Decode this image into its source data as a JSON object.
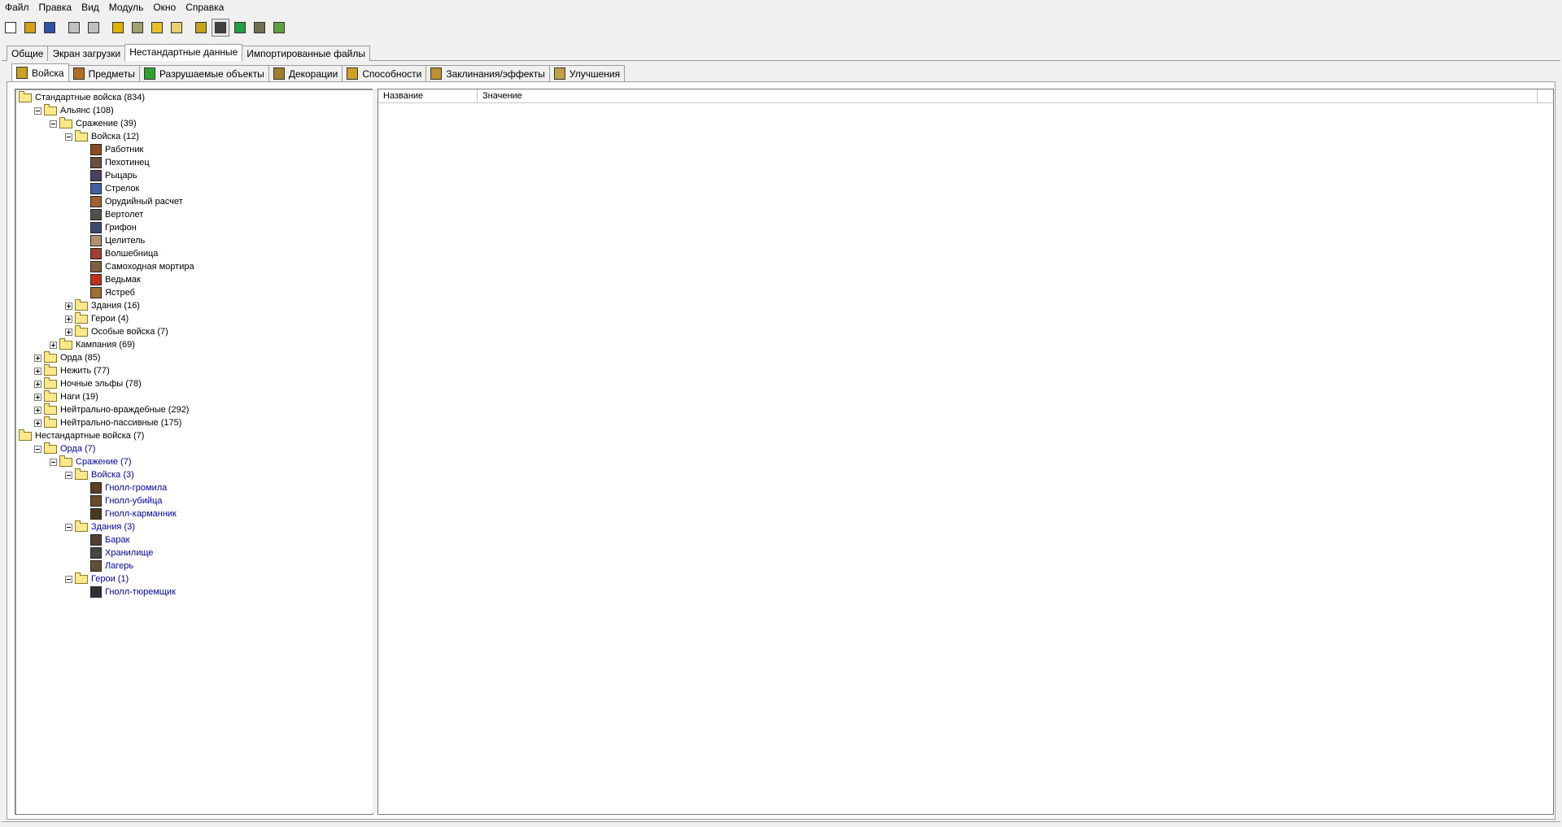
{
  "menu": [
    "Файл",
    "Правка",
    "Вид",
    "Модуль",
    "Окно",
    "Справка"
  ],
  "toolbar": {
    "icons": [
      "new-file-icon",
      "open-folder-icon",
      "save-icon",
      "copy-icon",
      "paste-icon",
      "unit-editor-icon",
      "terrain-icon",
      "gold-icon",
      "sound-icon",
      "unit-icon",
      "object-editor-icon",
      "ai-editor-icon",
      "campaign-icon",
      "import-icon"
    ],
    "colors": [
      "#ffffff",
      "#d4a017",
      "#3050a0",
      "#c0c0c0",
      "#c0c0c0",
      "#e0b000",
      "#a0a070",
      "#e8c020",
      "#e8d070",
      "#c8a020",
      "#404040",
      "#20a040",
      "#707050",
      "#60a040"
    ],
    "active_index": 10
  },
  "top_tabs": [
    "Общие",
    "Экран загрузки",
    "Нестандартные данные",
    "Импортированные файлы"
  ],
  "top_tab_active": 2,
  "object_tabs": [
    {
      "label": "Войска",
      "icon": "units-icon",
      "color": "#c8a020"
    },
    {
      "label": "Предметы",
      "icon": "items-icon",
      "color": "#b07020"
    },
    {
      "label": "Разрушаемые объекты",
      "icon": "destructibles-icon",
      "color": "#30a030"
    },
    {
      "label": "Декорации",
      "icon": "doodads-icon",
      "color": "#a08030"
    },
    {
      "label": "Способности",
      "icon": "abilities-icon",
      "color": "#d0a020"
    },
    {
      "label": "Заклинания/эффекты",
      "icon": "buffs-icon",
      "color": "#c09030"
    },
    {
      "label": "Улучшения",
      "icon": "upgrades-icon",
      "color": "#c0a040"
    }
  ],
  "object_tab_active": 0,
  "tree": [
    {
      "label": "Стандартные войска (834)",
      "level": 0,
      "kind": "folder",
      "expander": "none"
    },
    {
      "label": "Альянс (108)",
      "level": 1,
      "kind": "folder",
      "expander": "minus"
    },
    {
      "label": "Сражение (39)",
      "level": 2,
      "kind": "folder",
      "expander": "minus"
    },
    {
      "label": "Войска (12)",
      "level": 3,
      "kind": "folder",
      "expander": "minus"
    },
    {
      "label": "Работник",
      "level": 4,
      "kind": "unit",
      "color": "#8a4a20"
    },
    {
      "label": "Пехотинец",
      "level": 4,
      "kind": "unit",
      "color": "#6a5040"
    },
    {
      "label": "Рыцарь",
      "level": 4,
      "kind": "unit",
      "color": "#504060"
    },
    {
      "label": "Стрелок",
      "level": 4,
      "kind": "unit",
      "color": "#4060a0"
    },
    {
      "label": "Орудийный расчет",
      "level": 4,
      "kind": "unit",
      "color": "#a06030"
    },
    {
      "label": "Вертолет",
      "level": 4,
      "kind": "unit",
      "color": "#505050"
    },
    {
      "label": "Грифон",
      "level": 4,
      "kind": "unit",
      "color": "#3a4a70"
    },
    {
      "label": "Целитель",
      "level": 4,
      "kind": "unit",
      "color": "#b09070"
    },
    {
      "label": "Волшебница",
      "level": 4,
      "kind": "unit",
      "color": "#a04030"
    },
    {
      "label": "Самоходная мортира",
      "level": 4,
      "kind": "unit",
      "color": "#806040"
    },
    {
      "label": "Ведьмак",
      "level": 4,
      "kind": "unit",
      "color": "#c03020"
    },
    {
      "label": "Ястреб",
      "level": 4,
      "kind": "unit",
      "color": "#a07030"
    },
    {
      "label": "Здания (16)",
      "level": 3,
      "kind": "folder",
      "expander": "plus"
    },
    {
      "label": "Герои (4)",
      "level": 3,
      "kind": "folder",
      "expander": "plus"
    },
    {
      "label": "Особые войска (7)",
      "level": 3,
      "kind": "folder",
      "expander": "plus"
    },
    {
      "label": "Кампания (69)",
      "level": 2,
      "kind": "folder",
      "expander": "plus"
    },
    {
      "label": "Орда (85)",
      "level": 1,
      "kind": "folder",
      "expander": "plus"
    },
    {
      "label": "Нежить (77)",
      "level": 1,
      "kind": "folder",
      "expander": "plus"
    },
    {
      "label": "Ночные эльфы (78)",
      "level": 1,
      "kind": "folder",
      "expander": "plus"
    },
    {
      "label": "Наги (19)",
      "level": 1,
      "kind": "folder",
      "expander": "plus"
    },
    {
      "label": "Нейтрально-враждебные (292)",
      "level": 1,
      "kind": "folder",
      "expander": "plus"
    },
    {
      "label": "Нейтрально-пассивные (175)",
      "level": 1,
      "kind": "folder",
      "expander": "plus"
    },
    {
      "label": "Нестандартные войска (7)",
      "level": 0,
      "kind": "folder",
      "expander": "none"
    },
    {
      "label": "Орда (7)",
      "level": 1,
      "kind": "folder",
      "expander": "minus",
      "custom": true
    },
    {
      "label": "Сражение (7)",
      "level": 2,
      "kind": "folder",
      "expander": "minus",
      "custom": true
    },
    {
      "label": "Войска (3)",
      "level": 3,
      "kind": "folder",
      "expander": "minus",
      "custom": true
    },
    {
      "label": "Гнолл-громила",
      "level": 4,
      "kind": "unit",
      "custom": true,
      "color": "#5a4020"
    },
    {
      "label": "Гнолл-убийца",
      "level": 4,
      "kind": "unit",
      "custom": true,
      "color": "#6a4a28"
    },
    {
      "label": "Гнолл-карманник",
      "level": 4,
      "kind": "unit",
      "custom": true,
      "color": "#4a3a20"
    },
    {
      "label": "Здания (3)",
      "level": 3,
      "kind": "folder",
      "expander": "minus",
      "custom": true
    },
    {
      "label": "Барак",
      "level": 4,
      "kind": "unit",
      "custom": true,
      "color": "#504030"
    },
    {
      "label": "Хранилище",
      "level": 4,
      "kind": "unit",
      "custom": true,
      "color": "#404848"
    },
    {
      "label": "Лагерь",
      "level": 4,
      "kind": "unit",
      "custom": true,
      "color": "#605038"
    },
    {
      "label": "Герои (1)",
      "level": 3,
      "kind": "folder",
      "expander": "minus",
      "custom": true
    },
    {
      "label": "Гнолл-тюремщик",
      "level": 4,
      "kind": "unit",
      "custom": true,
      "color": "#303038"
    }
  ],
  "grid": {
    "columns": [
      "Название",
      "Значение"
    ]
  }
}
